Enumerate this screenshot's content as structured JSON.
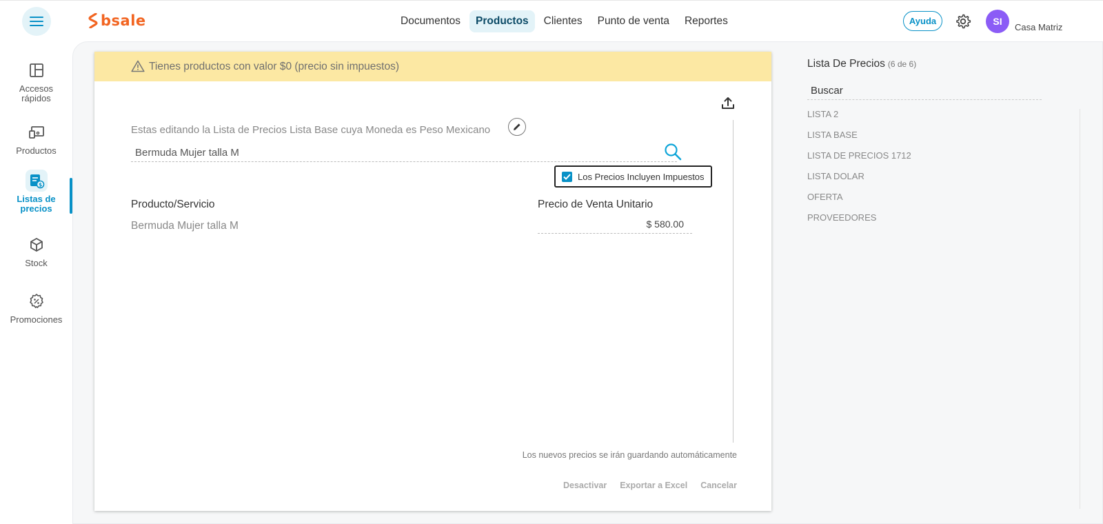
{
  "brand": {
    "name": "bsale",
    "color": "#f26522"
  },
  "accent": "#0891c7",
  "nav": {
    "items": [
      "Documentos",
      "Productos",
      "Clientes",
      "Punto de venta",
      "Reportes"
    ],
    "active": "Productos"
  },
  "header": {
    "help_label": "Ayuda",
    "avatar_initials": "SI",
    "branch": "Casa Matriz"
  },
  "sidebar": {
    "items": [
      {
        "label": "Accesos rápidos",
        "icon": "dashboard-icon"
      },
      {
        "label": "Productos",
        "icon": "devices-icon"
      },
      {
        "label": "Listas de precios",
        "icon": "price-list-icon",
        "active": true
      },
      {
        "label": "Stock",
        "icon": "box-icon"
      },
      {
        "label": "Promociones",
        "icon": "discount-badge-icon"
      }
    ]
  },
  "main": {
    "warning": "Tienes productos con valor $0 (precio sin impuestos)",
    "editing_text": "Estas editando la Lista de Precios Lista Base cuya Moneda es Peso Mexicano",
    "search_value": "Bermuda Mujer talla M",
    "checkbox": {
      "label": "Los Precios Incluyen Impuestos",
      "checked": true
    },
    "table": {
      "columns": [
        "Producto/Servicio",
        "Precio de Venta Unitario"
      ],
      "rows": [
        {
          "product": "Bermuda Mujer talla M",
          "price": "$ 580.00"
        }
      ]
    },
    "autosave_note": "Los nuevos precios se irán guardando automáticamente",
    "actions": [
      "Desactivar",
      "Exportar a Excel",
      "Cancelar"
    ]
  },
  "price_lists": {
    "title": "Lista De Precios",
    "count": "(6 de 6)",
    "search_value": "Buscar",
    "items": [
      "LISTA 2",
      "LISTA BASE",
      "LISTA DE PRECIOS 1712",
      "LISTA DOLAR",
      "OFERTA",
      "PROVEEDORES"
    ]
  }
}
